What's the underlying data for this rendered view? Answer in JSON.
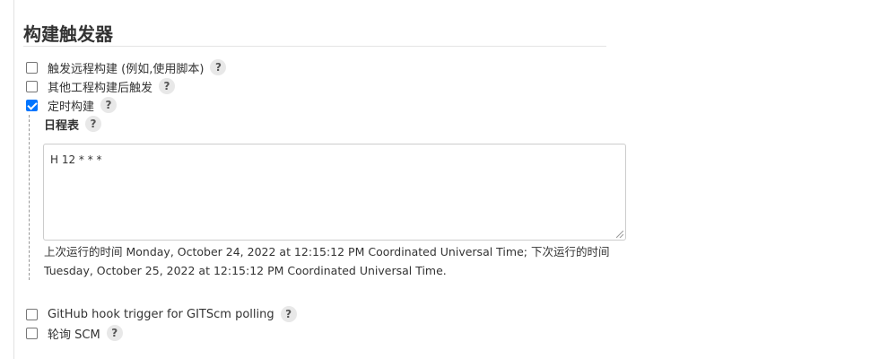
{
  "section": {
    "title": "构建触发器"
  },
  "triggers": [
    {
      "label": "触发远程构建 (例如,使用脚本)",
      "checked": false
    },
    {
      "label": "其他工程构建后触发",
      "checked": false
    },
    {
      "label": "定时构建",
      "checked": true
    }
  ],
  "help_label": "?",
  "schedule": {
    "label": "日程表",
    "value": "H 12 * * *",
    "description": "上次运行的时间 Monday, October 24, 2022 at 12:15:12 PM Coordinated Universal Time; 下次运行的时间 Tuesday, October 25, 2022 at 12:15:12 PM Coordinated Universal Time."
  },
  "more_triggers": [
    {
      "label": "GitHub hook trigger for GITScm polling",
      "checked": false
    },
    {
      "label": "轮询 SCM",
      "checked": false
    }
  ]
}
